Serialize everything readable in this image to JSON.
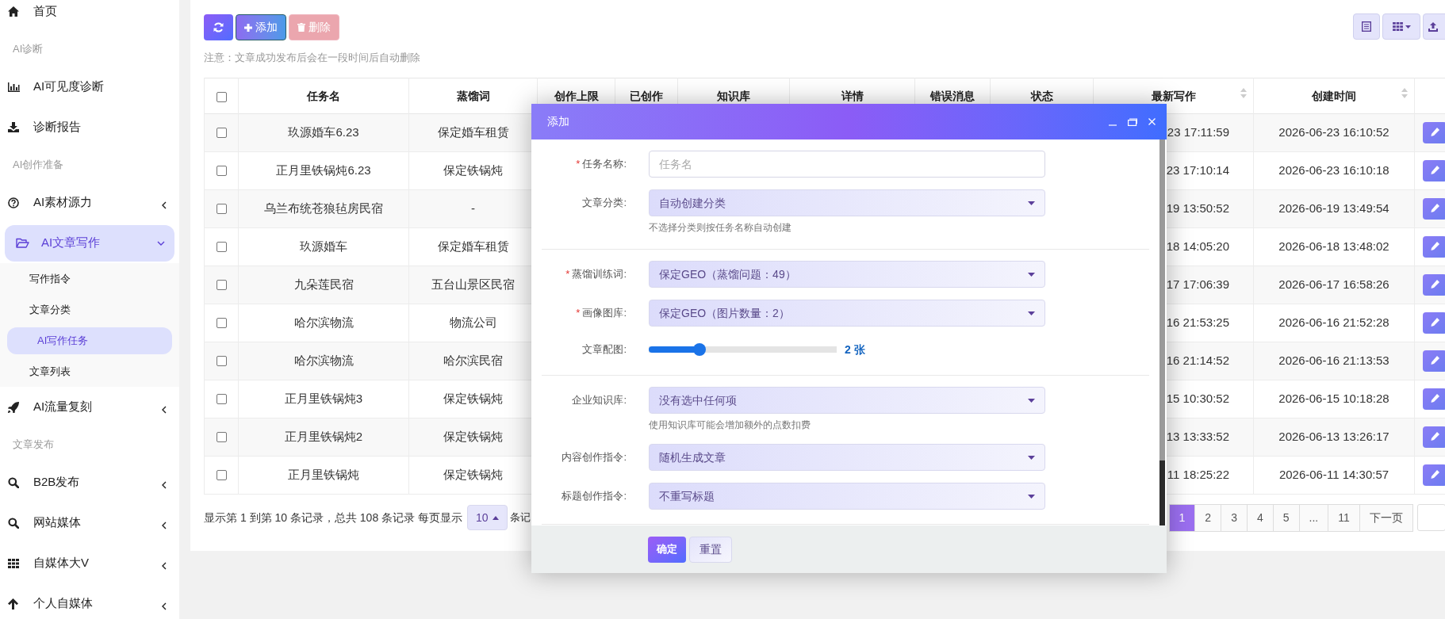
{
  "sidebar": {
    "items": [
      {
        "kind": "link",
        "label": "首页",
        "selected": false
      },
      {
        "kind": "heading",
        "label": "AI诊断"
      },
      {
        "kind": "link",
        "label": "AI可见度诊断",
        "selected": false
      },
      {
        "kind": "link",
        "label": "诊断报告",
        "selected": false
      },
      {
        "kind": "heading",
        "label": "AI创作准备"
      },
      {
        "kind": "group",
        "label": "AI素材源力",
        "selected": false,
        "expanded": false
      },
      {
        "kind": "group",
        "label": "AI文章写作",
        "selected": true,
        "expanded": true,
        "children": [
          {
            "label": "写作指令",
            "selected": false
          },
          {
            "label": "文章分类",
            "selected": false
          },
          {
            "label": "AI写作任务",
            "selected": true
          },
          {
            "label": "文章列表",
            "selected": false
          }
        ]
      },
      {
        "kind": "group",
        "label": "AI流量复刻",
        "selected": false,
        "expanded": false
      },
      {
        "kind": "heading",
        "label": "文章发布"
      },
      {
        "kind": "group",
        "label": "B2B发布",
        "selected": false,
        "expanded": false
      },
      {
        "kind": "group",
        "label": "网站媒体",
        "selected": false,
        "expanded": false
      },
      {
        "kind": "group",
        "label": "自媒体大V",
        "selected": false,
        "expanded": false
      },
      {
        "kind": "group",
        "label": "个人自媒体",
        "selected": false,
        "expanded": false
      }
    ]
  },
  "toolbar": {
    "buttons": [
      {
        "kind": "refresh",
        "disabled": false
      },
      {
        "kind": "add",
        "label": "添加",
        "disabled": false
      },
      {
        "kind": "delete",
        "label": "删除",
        "disabled": true
      }
    ],
    "note": "注意：文章成功发布后会在一段时间后自动删除"
  },
  "table": {
    "all_checked": false,
    "columns": [
      {
        "label": "任务名",
        "sortable": false
      },
      {
        "label": "蒸馏词",
        "sortable": false
      },
      {
        "label": "创作上限",
        "sortable": false
      },
      {
        "label": "已创作",
        "sortable": false
      },
      {
        "label": "知识库",
        "sortable": false
      },
      {
        "label": "详情",
        "sortable": false
      },
      {
        "label": "错误消息",
        "sortable": false
      },
      {
        "label": "状态",
        "sortable": false
      },
      {
        "label": "最新写作",
        "sortable": true
      },
      {
        "label": "创建时间",
        "sortable": true
      }
    ],
    "rows": [
      {
        "checked": false,
        "name": "玖源婚车6.23",
        "keyword": "保定婚车租赁",
        "latest": "23 17:11:59",
        "created": "2026-06-23 16:10:52"
      },
      {
        "checked": false,
        "name": "正月里铁锅炖6.23",
        "keyword": "保定铁锅炖",
        "latest": "23 17:10:14",
        "created": "2026-06-23 16:10:18"
      },
      {
        "checked": false,
        "name": "乌兰布统苍狼毡房民宿",
        "keyword": "-",
        "latest": "19 13:50:52",
        "created": "2026-06-19 13:49:54"
      },
      {
        "checked": false,
        "name": "玖源婚车",
        "keyword": "保定婚车租赁",
        "latest": "18 14:05:20",
        "created": "2026-06-18 13:48:02"
      },
      {
        "checked": false,
        "name": "九朵莲民宿",
        "keyword": "五台山景区民宿",
        "latest": "17 17:06:39",
        "created": "2026-06-17 16:58:26"
      },
      {
        "checked": false,
        "name": "哈尔滨物流",
        "keyword": "物流公司",
        "latest": "16 21:53:25",
        "created": "2026-06-16 21:52:28"
      },
      {
        "checked": false,
        "name": "哈尔滨物流",
        "keyword": "哈尔滨民宿",
        "latest": "16 21:14:52",
        "created": "2026-06-16 21:13:53"
      },
      {
        "checked": false,
        "name": "正月里铁锅炖3",
        "keyword": "保定铁锅炖",
        "latest": "15 10:30:52",
        "created": "2026-06-15 10:18:28"
      },
      {
        "checked": false,
        "name": "正月里铁锅炖2",
        "keyword": "保定铁锅炖",
        "latest": "13 13:33:52",
        "created": "2026-06-13 13:26:17"
      },
      {
        "checked": false,
        "name": "正月里铁锅炖",
        "keyword": "保定铁锅炖",
        "latest": "11 18:25:22",
        "created": "2026-06-11 14:30:57"
      }
    ]
  },
  "pagination": {
    "summary": "显示第 1 到第 10 条记录，总共 108 条记录 每页显示",
    "page_size": "10",
    "suffix": "条记",
    "pages": [
      {
        "label": "1",
        "selected": true
      },
      {
        "label": "2",
        "selected": false
      },
      {
        "label": "3",
        "selected": false
      },
      {
        "label": "4",
        "selected": false
      },
      {
        "label": "5",
        "selected": false
      },
      {
        "label": "...",
        "selected": false
      },
      {
        "label": "11",
        "selected": false
      }
    ],
    "next": "下一页"
  },
  "dialog": {
    "title": "添加",
    "sections": [
      [
        {
          "kind": "text",
          "label": "任务名称:",
          "required_mark": "*",
          "placeholder": "任务名"
        },
        {
          "kind": "select",
          "label": "文章分类:",
          "value": "自动创建分类",
          "hint": "不选择分类则按任务名称自动创建"
        }
      ],
      [
        {
          "kind": "select",
          "label": "蒸馏训练词:",
          "required_mark": "*",
          "value": "保定GEO（蒸馏问题：49）"
        },
        {
          "kind": "select",
          "label": "画像图库:",
          "required_mark": "*",
          "value": "保定GEO（图片数量：2）"
        },
        {
          "kind": "slider",
          "label": "文章配图:",
          "level": 0.27,
          "reading": "2 张"
        }
      ],
      [
        {
          "kind": "select",
          "label": "企业知识库:",
          "value": "没有选中任何项",
          "hint": "使用知识库可能会增加额外的点数扣费"
        },
        {
          "kind": "select",
          "label": "内容创作指令:",
          "value": "随机生成文章"
        },
        {
          "kind": "select",
          "label": "标题创作指令:",
          "value": "不重写标题"
        }
      ]
    ],
    "buttons": [
      {
        "kind": "primary",
        "label": "确定"
      },
      {
        "kind": "secondary",
        "label": "重置"
      }
    ]
  }
}
